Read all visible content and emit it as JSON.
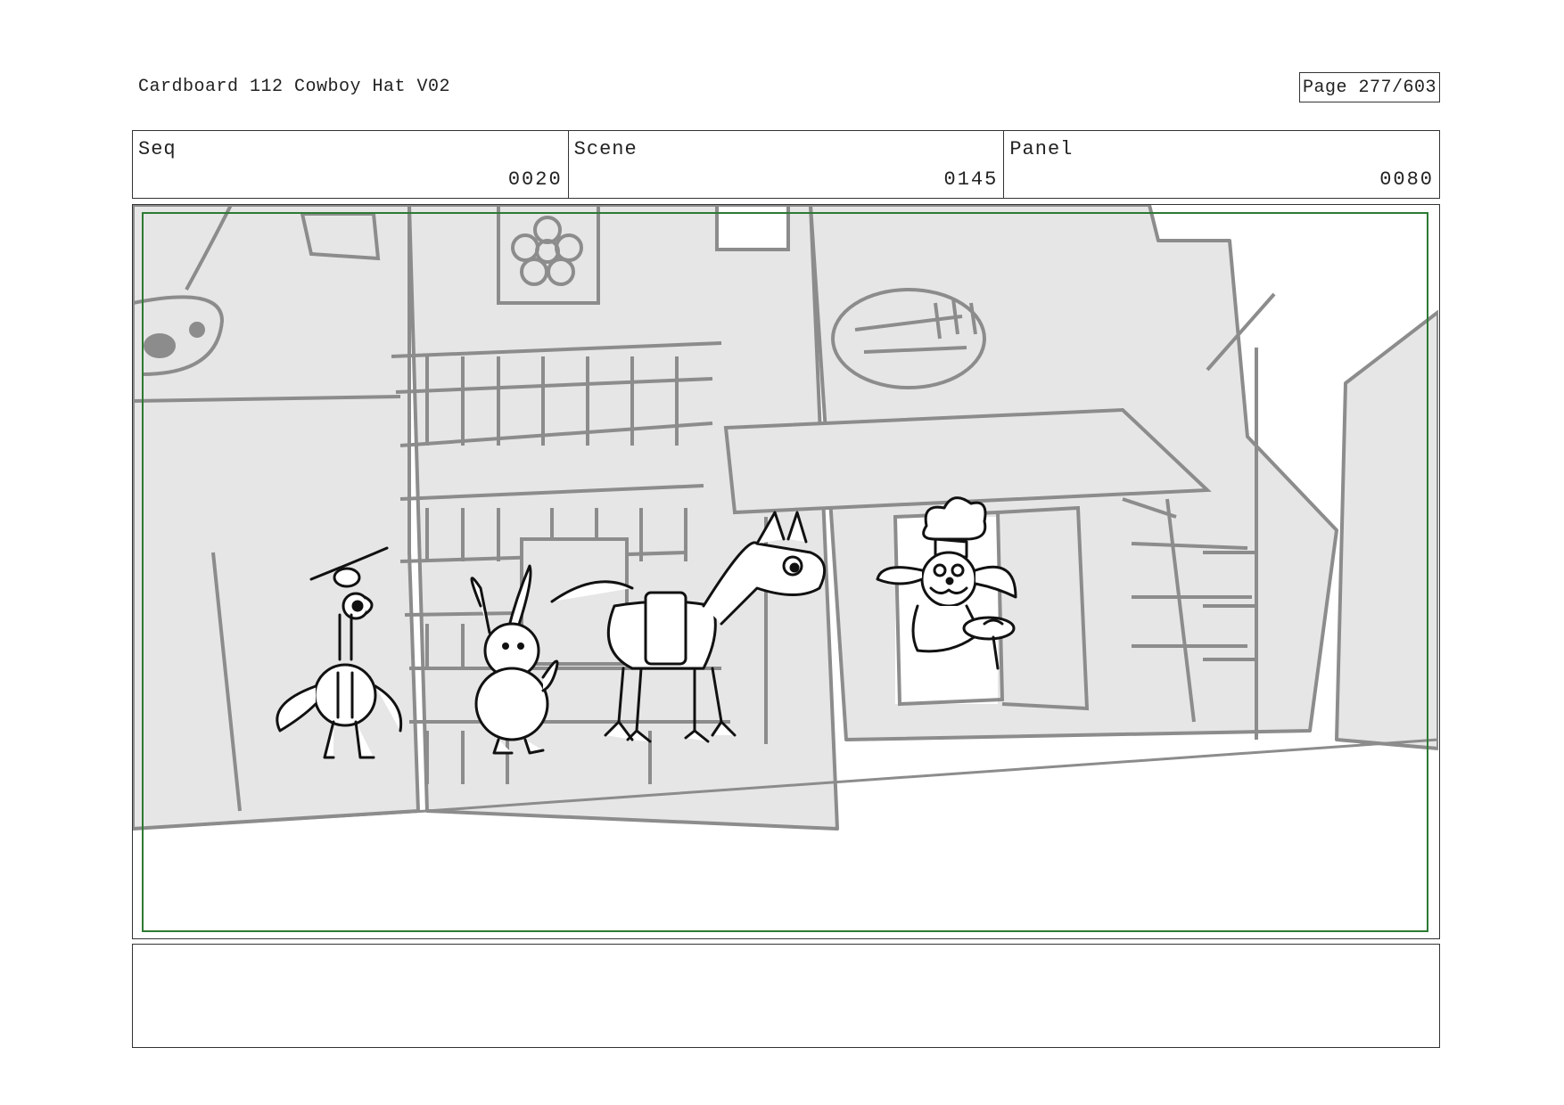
{
  "header": {
    "title": "Cardboard 112 Cowboy Hat V02",
    "page_label": "Page 277/603"
  },
  "meta": {
    "seq": {
      "label": "Seq",
      "value": "0020"
    },
    "scene": {
      "label": "Scene",
      "value": "0145"
    },
    "panel": {
      "label": "Panel",
      "value": "0080"
    }
  },
  "notes": {
    "text": ""
  },
  "colors": {
    "safe_frame": "#2d7a33",
    "building_fill": "#e6e6e6",
    "building_line": "#8c8c8c",
    "character_line": "#111111"
  }
}
